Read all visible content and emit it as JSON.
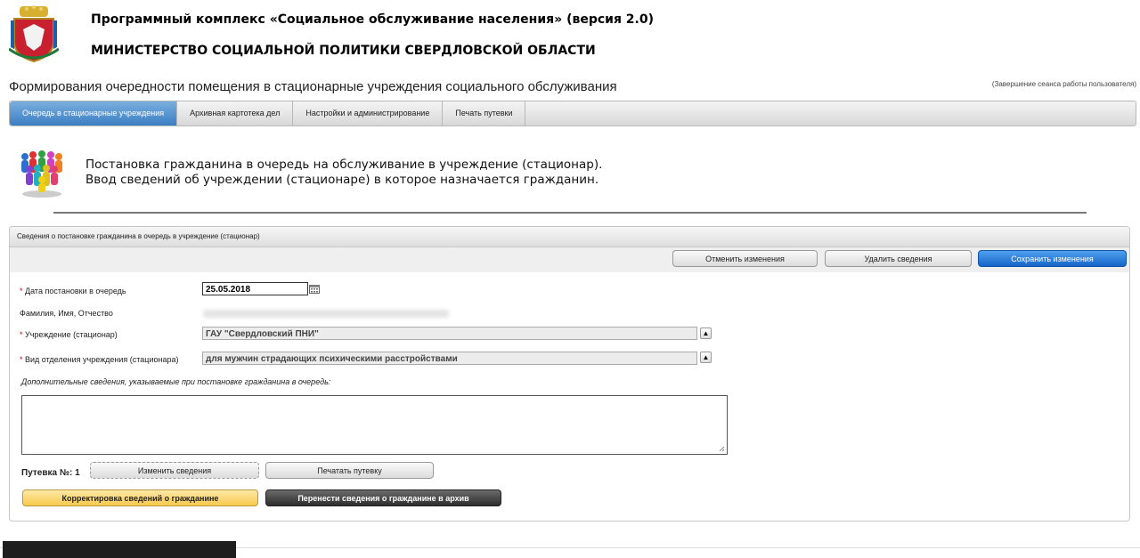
{
  "header": {
    "app_title": "Программный комплекс «Социальное обслуживание населения» (версия 2.0)",
    "ministry": "МИНИСТЕРСТВО СОЦИАЛЬНОЙ ПОЛИТИКИ СВЕРДЛОВСКОЙ ОБЛАСТИ"
  },
  "page": {
    "title": "Формирования очередности помещения в стационарные учреждения социального обслуживания",
    "logout": "(Завершение сеанса работы пользователя)"
  },
  "tabs": [
    {
      "label": "Очередь в стационарные учреждения",
      "active": true
    },
    {
      "label": "Архивная картотека дел"
    },
    {
      "label": "Настройки и администрирование"
    },
    {
      "label": "Печать путевки"
    }
  ],
  "info": {
    "line1": "Постановка гражданина в очередь на обслуживание в учреждение (стационар).",
    "line2": "Ввод сведений об учреждении (стационаре) в которое назначается гражданин."
  },
  "panel": {
    "title": "Сведения о постановке гражданина в очередь в учреждение (стационар)",
    "cancel_label": "Отменить изменения",
    "delete_label": "Удалить сведения",
    "save_label": "Сохранить изменения"
  },
  "form": {
    "date_label": "Дата постановки в очередь",
    "date_value": "25.05.2018",
    "fio_label": "Фамилия, Имя, Отчество",
    "institution_label": "Учреждение (стационар)",
    "institution_value": "ГАУ \"Свердловский ПНИ\"",
    "department_label": "Вид отделения учреждения (стационара)",
    "department_value": "для мужчин страдающих психическими расстройствами",
    "additional_label": "Дополнительные сведения, указываемые при постановке гражданина в очередь:",
    "voucher_label": "Путевка №: 1",
    "edit_label": "Изменить сведения",
    "print_label": "Печатать путевку",
    "correct_label": "Корректировка сведений о гражданине",
    "archive_label": "Перенести сведения о гражданине в архив"
  },
  "colors": {
    "accent_blue": "#1565c9",
    "active_tab": "#3b7fc4",
    "required": "#dd0000",
    "yellow_button": "#f7c94e"
  },
  "icons": [
    "coat-of-arms-logo",
    "people-group-icon",
    "calendar-icon",
    "scroll-up-icon",
    "resize-grip-icon"
  ]
}
